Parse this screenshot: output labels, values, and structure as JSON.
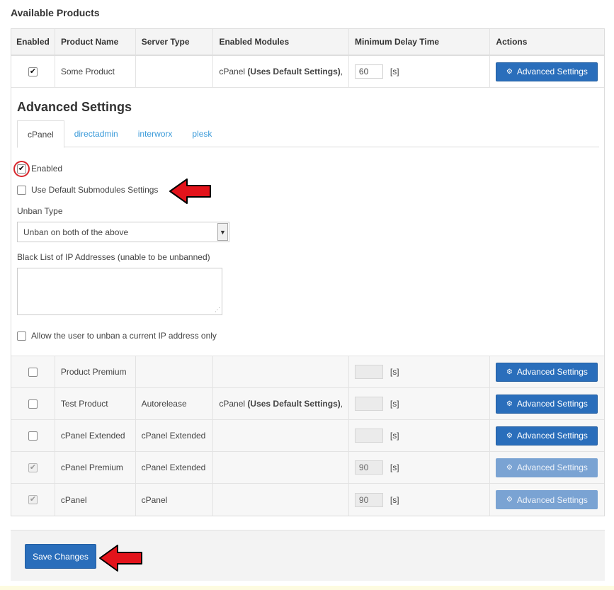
{
  "section_title": "Available Products",
  "table": {
    "headers": [
      "Enabled",
      "Product Name",
      "Server Type",
      "Enabled Modules",
      "Minimum Delay Time",
      "Actions"
    ],
    "delay_unit": "[s]",
    "action_label": "Advanced Settings",
    "first_row": {
      "enabled": true,
      "name": "Some Product",
      "server_type": "",
      "modules_name": "cPanel",
      "modules_note": "(Uses Default Settings)",
      "modules_suffix": ",",
      "delay": "60"
    },
    "rows": [
      {
        "enabled": false,
        "name": "Product Premium",
        "server_type": "",
        "modules_name": "",
        "modules_note": "",
        "modules_suffix": "",
        "delay": "",
        "locked": false
      },
      {
        "enabled": false,
        "name": "Test Product",
        "server_type": "Autorelease",
        "modules_name": "cPanel",
        "modules_note": "(Uses Default Settings)",
        "modules_suffix": ",",
        "delay": "",
        "locked": false
      },
      {
        "enabled": false,
        "name": "cPanel Extended",
        "server_type": "cPanel Extended",
        "modules_name": "",
        "modules_note": "",
        "modules_suffix": "",
        "delay": "",
        "locked": false
      },
      {
        "enabled": true,
        "name": "cPanel Premium",
        "server_type": "cPanel Extended",
        "modules_name": "",
        "modules_note": "",
        "modules_suffix": "",
        "delay": "90",
        "locked": true
      },
      {
        "enabled": true,
        "name": "cPanel",
        "server_type": "cPanel",
        "modules_name": "",
        "modules_note": "",
        "modules_suffix": "",
        "delay": "90",
        "locked": true
      }
    ]
  },
  "advanced": {
    "title": "Advanced Settings",
    "tabs": [
      "cPanel",
      "directadmin",
      "interworx",
      "plesk"
    ],
    "active_tab": 0,
    "enabled_label": "Enabled",
    "enabled_checked": true,
    "use_default_label": "Use Default Submodules Settings",
    "use_default_checked": false,
    "unban_type_label": "Unban Type",
    "unban_type_value": "Unban on both of the above",
    "blacklist_label": "Black List of IP Addresses (unable to be unbanned)",
    "blacklist_value": "",
    "allow_current_label": "Allow the user to unban a current IP address only",
    "allow_current_checked": false
  },
  "save_label": "Save Changes",
  "colors": {
    "primary": "#2a6ebb",
    "link": "#3a9ad9",
    "annotation": "#e3131b"
  },
  "icons": {
    "checkmark": "check-icon",
    "settings": "gears-icon",
    "select_arrow": "chevron-down-icon",
    "annotation": "red-arrow-icon"
  }
}
